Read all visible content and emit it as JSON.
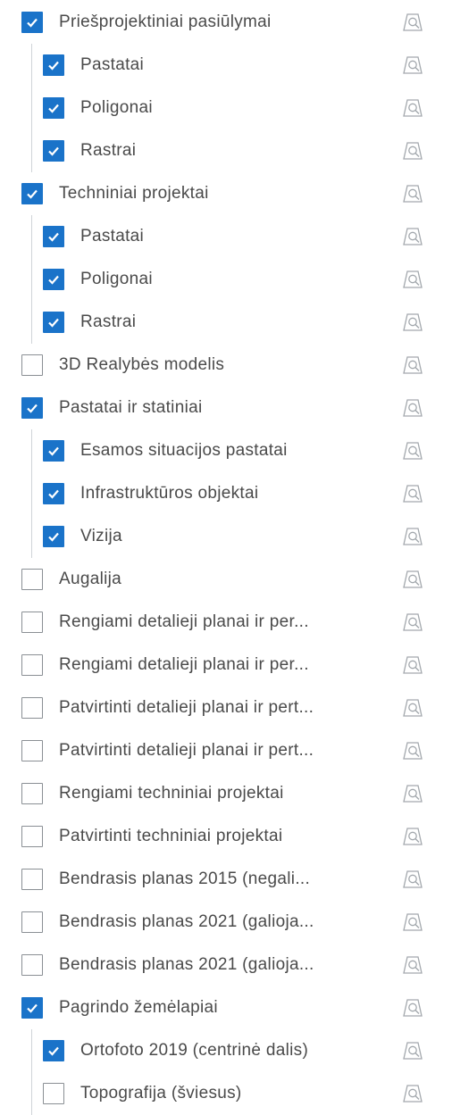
{
  "layers": [
    {
      "label": "Priešprojektiniai pasiūlymai",
      "checked": true,
      "level": 0
    },
    {
      "label": "Pastatai",
      "checked": true,
      "level": 1
    },
    {
      "label": "Poligonai",
      "checked": true,
      "level": 1
    },
    {
      "label": "Rastrai",
      "checked": true,
      "level": 1
    },
    {
      "label": "Techniniai projektai",
      "checked": true,
      "level": 0
    },
    {
      "label": "Pastatai",
      "checked": true,
      "level": 1
    },
    {
      "label": "Poligonai",
      "checked": true,
      "level": 1
    },
    {
      "label": "Rastrai",
      "checked": true,
      "level": 1
    },
    {
      "label": "3D Realybės modelis",
      "checked": false,
      "level": 0
    },
    {
      "label": "Pastatai ir statiniai",
      "checked": true,
      "level": 0
    },
    {
      "label": "Esamos situacijos pastatai",
      "checked": true,
      "level": 1
    },
    {
      "label": "Infrastruktūros objektai",
      "checked": true,
      "level": 1
    },
    {
      "label": "Vizija",
      "checked": true,
      "level": 1
    },
    {
      "label": "Augalija",
      "checked": false,
      "level": 0
    },
    {
      "label": "Rengiami detalieji planai ir per...",
      "checked": false,
      "level": 0
    },
    {
      "label": "Rengiami detalieji planai ir per...",
      "checked": false,
      "level": 0
    },
    {
      "label": "Patvirtinti detalieji planai ir pert...",
      "checked": false,
      "level": 0
    },
    {
      "label": "Patvirtinti detalieji planai ir pert...",
      "checked": false,
      "level": 0
    },
    {
      "label": "Rengiami techniniai projektai",
      "checked": false,
      "level": 0
    },
    {
      "label": "Patvirtinti techniniai projektai",
      "checked": false,
      "level": 0
    },
    {
      "label": "Bendrasis planas 2015 (negali...",
      "checked": false,
      "level": 0
    },
    {
      "label": "Bendrasis planas 2021 (galioja...",
      "checked": false,
      "level": 0
    },
    {
      "label": "Bendrasis planas 2021 (galioja...",
      "checked": false,
      "level": 0
    },
    {
      "label": "Pagrindo žemėlapiai",
      "checked": true,
      "level": 0
    },
    {
      "label": "Ortofoto 2019 (centrinė dalis)",
      "checked": true,
      "level": 1
    },
    {
      "label": "Topografija (šviesus)",
      "checked": false,
      "level": 1
    }
  ],
  "icons": {
    "checkbox": "checkmark-icon",
    "zoom": "zoom-to-layer-icon"
  },
  "colors": {
    "accent": "#1a73c9",
    "text": "#4a4a4a",
    "icon": "#9aa0a6",
    "tree_line": "#cfd4d8"
  }
}
